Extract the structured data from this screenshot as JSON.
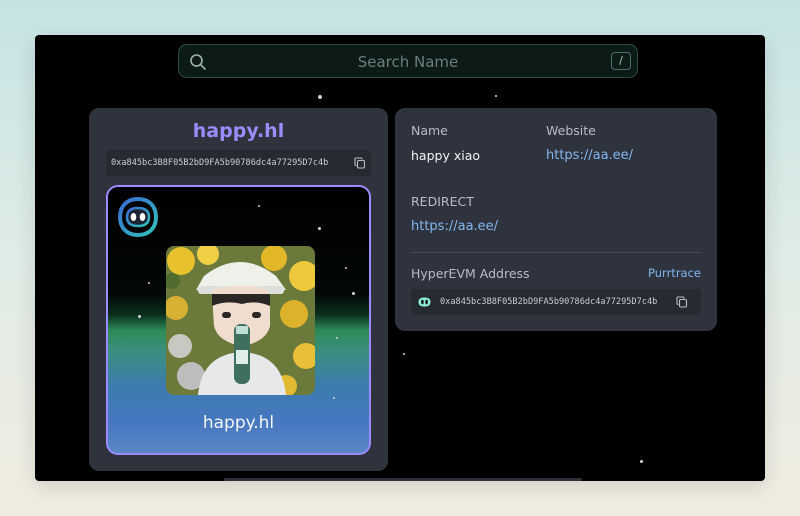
{
  "search": {
    "placeholder": "Search Name",
    "shortcut": "/"
  },
  "profile": {
    "domain": "happy.hl",
    "address": "0xa845bc3B8F05B2bD9FA5b90786dc4a77295D7c4b",
    "nft_name": "happy.hl"
  },
  "details": {
    "name_label": "Name",
    "name_value": "happy xiao",
    "website_label": "Website",
    "website_value": "https://aa.ee/",
    "redirect_label": "REDIRECT",
    "redirect_value": "https://aa.ee/",
    "evm_label": "HyperEVM Address",
    "explorer_link": "Purrtrace",
    "evm_address": "0xa845bc3B8F05B2bD9FA5b90786dc4a77295D7c4b"
  },
  "colors": {
    "accent_purple": "#9b8cff",
    "link_blue": "#82b6ef",
    "card_bg": "#2e333d",
    "page_bg": "#000000"
  },
  "icons": [
    "search-icon",
    "copy-icon",
    "hyperliquid-logo-icon",
    "hyperliquid-small-icon"
  ]
}
